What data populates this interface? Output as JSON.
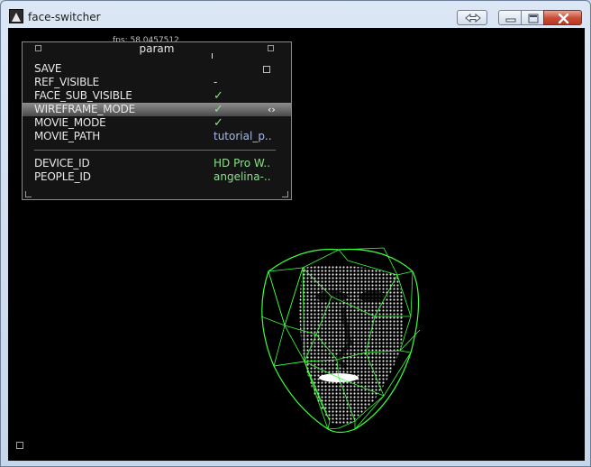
{
  "window": {
    "title": "face-switcher",
    "app_icon": "app-icon",
    "controls": [
      "swap-icon",
      "minimize-icon",
      "maximize-icon",
      "close-icon"
    ]
  },
  "viewport": {
    "fps_text": "fps: 58.0457512"
  },
  "param_panel": {
    "title": "param",
    "rows": [
      {
        "label": "SAVE",
        "value": "",
        "kind": "checkbox"
      },
      {
        "label": "REF_VISIBLE",
        "value": "-",
        "kind": "dash"
      },
      {
        "label": "FACE_SUB_VISIBLE",
        "value": "✓",
        "kind": "check"
      },
      {
        "label": "WIREFRAME_MODE",
        "value": "✓",
        "kind": "check",
        "selected": true
      },
      {
        "label": "MOVIE_MODE",
        "value": "✓",
        "kind": "check"
      },
      {
        "label": "MOVIE_PATH",
        "value": "tutorial_p..",
        "kind": "path"
      },
      {
        "label": "DEVICE_ID",
        "value": "HD Pro W..",
        "kind": "green"
      },
      {
        "label": "PEOPLE_ID",
        "value": "angelina-..",
        "kind": "green"
      }
    ],
    "selected_row_arrows": "‹›"
  },
  "colors": {
    "wireframe": "#3cff3c",
    "panel_bg": "#141414",
    "viewport_bg": "#000000"
  }
}
